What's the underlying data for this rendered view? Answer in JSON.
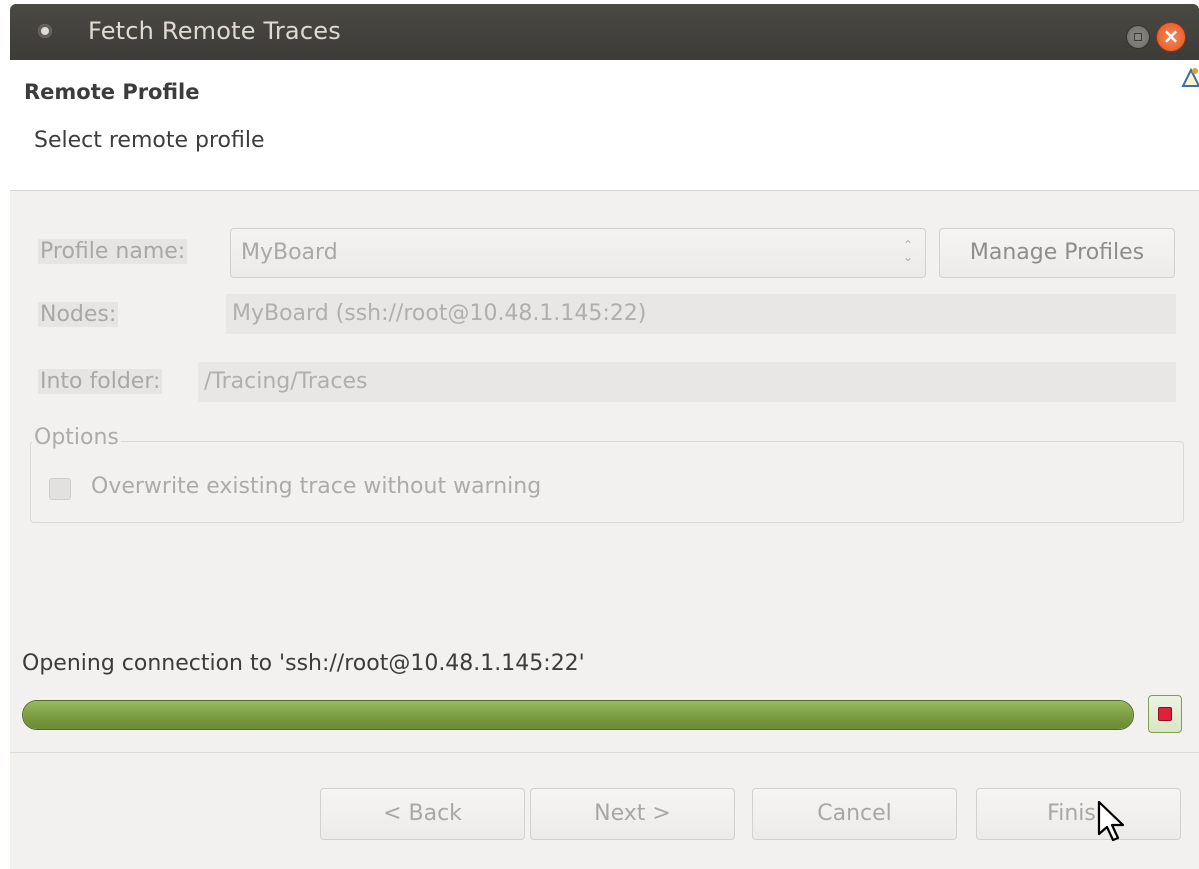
{
  "window": {
    "title": "Fetch Remote Traces",
    "close_glyph": "×"
  },
  "header": {
    "title": "Remote Profile",
    "subtitle": "Select remote profile"
  },
  "form": {
    "profile_label": "Profile name:",
    "profile_value": "MyBoard",
    "combo_arrows": "⌃⌄",
    "manage_button": "Manage Profiles",
    "nodes_label": "Nodes:",
    "nodes_value": "MyBoard (ssh://root@10.48.1.145:22)",
    "folder_label": "Into folder:",
    "folder_value": "/Tracing/Traces"
  },
  "options": {
    "group_title": "Options",
    "overwrite_label": "Overwrite existing trace without warning",
    "overwrite_checked": false
  },
  "progress": {
    "status_text": "Opening connection to 'ssh://root@10.48.1.145:22'",
    "fraction": 1.0,
    "fill_color": "#7a9c42"
  },
  "buttons": {
    "back": "< Back",
    "next": "Next >",
    "cancel": "Cancel",
    "finish": "Finish"
  },
  "icons": {
    "wizard": "wizard-banner-icon",
    "stop": "stop-icon",
    "window_menu": "window-menu-icon",
    "maximize": "maximize-icon",
    "close": "close-icon"
  }
}
